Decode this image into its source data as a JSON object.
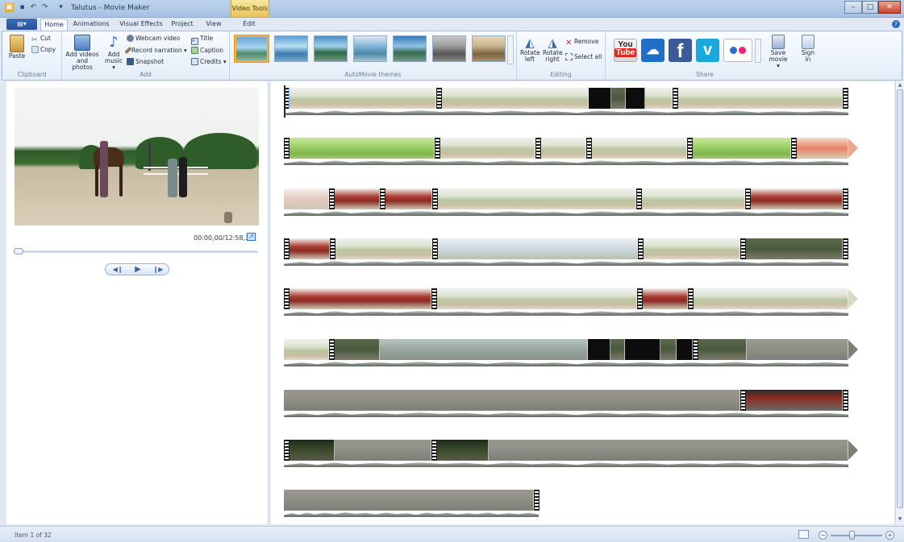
{
  "window": {
    "title": "Talutus - Movie Maker",
    "context_tab": "Video Tools"
  },
  "tabs": {
    "file": "▤▾",
    "home": "Home",
    "animations": "Animations",
    "visual_effects": "Visual Effects",
    "project": "Project",
    "view": "View",
    "edit": "Edit"
  },
  "ribbon": {
    "clipboard": {
      "label": "Clipboard",
      "paste": "Paste",
      "cut": "Cut",
      "copy": "Copy"
    },
    "add": {
      "label": "Add",
      "add_videos": "Add videos",
      "add_videos2": "and photos",
      "add_music": "Add",
      "add_music2": "music ▾",
      "webcam": "Webcam video",
      "narration": "Record narration ▾",
      "snapshot": "Snapshot",
      "title": "Title",
      "caption": "Caption",
      "credits": "Credits ▾"
    },
    "themes": {
      "label": "AutoMovie themes"
    },
    "editing": {
      "label": "Editing",
      "rotate_left": "Rotate",
      "rotate_left2": "left",
      "rotate_right": "Rotate",
      "rotate_right2": "right",
      "remove": "Remove",
      "select_all": "Select all"
    },
    "share": {
      "label": "Share",
      "youtube": "You\nTube",
      "save_movie": "Save",
      "save_movie2": "movie ▾",
      "sign_in": "Sign",
      "sign_in2": "in"
    }
  },
  "preview": {
    "timecode": "00:00,00/12:58,31"
  },
  "status": {
    "text": "Item 1 of 32"
  },
  "colors": {
    "accent": "#2f6bbf",
    "selected_theme": "#f2b13c"
  }
}
